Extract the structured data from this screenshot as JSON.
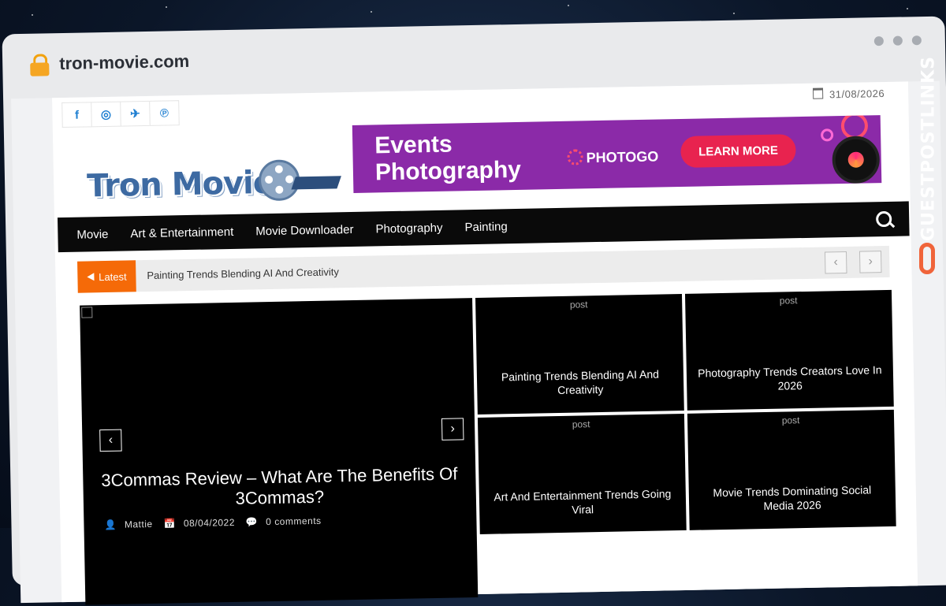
{
  "browser": {
    "url": "tron-movie.com"
  },
  "topbar": {
    "social_icons": [
      "facebook-icon",
      "instagram-icon",
      "twitter-icon",
      "pinterest-icon"
    ],
    "date": "31/08/2026"
  },
  "logo": {
    "text": "Tron Movie"
  },
  "banner": {
    "title": "Events\nPhotography",
    "brand": "PHOTOGO",
    "cta": "LEARN MORE"
  },
  "nav": {
    "items": [
      "Movie",
      "Art & Entertainment",
      "Movie Downloader",
      "Photography",
      "Painting"
    ]
  },
  "ticker": {
    "label": "Latest",
    "headline": "Painting Trends Blending AI And Creativity"
  },
  "featured": {
    "headline": "3Commas Review – What Are The Benefits Of 3Commas?",
    "author": "Mattie",
    "date": "08/04/2022",
    "comments": "0 comments"
  },
  "posts": [
    {
      "alt": "post",
      "title": "Painting Trends Blending AI And Creativity"
    },
    {
      "alt": "post",
      "title": "Photography Trends Creators Love In 2026"
    },
    {
      "alt": "post",
      "title": "Art And Entertainment Trends Going Viral"
    },
    {
      "alt": "post",
      "title": "Movie Trends Dominating Social Media 2026"
    }
  ],
  "watermark": "GUESTPOSTLINKS",
  "colors": {
    "accent": "#f56a08",
    "nav_bg": "#0a0a0a",
    "banner_bg": "#8b2aa8",
    "cta": "#e8234f"
  }
}
